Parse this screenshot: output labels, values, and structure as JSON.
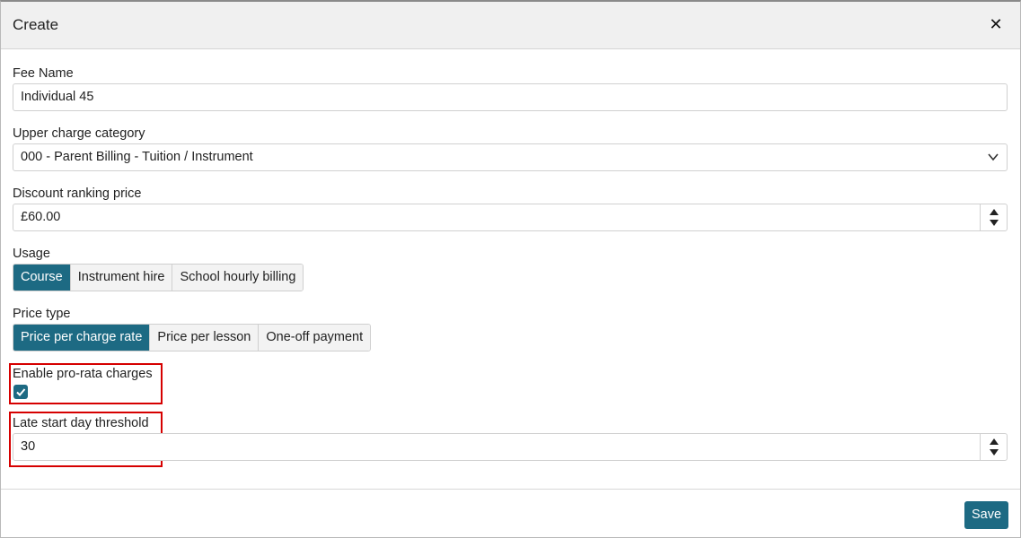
{
  "dialog": {
    "title": "Create",
    "close_icon": "close-icon"
  },
  "fields": {
    "fee_name": {
      "label": "Fee Name",
      "value": "Individual 45"
    },
    "upper_charge_category": {
      "label": "Upper charge category",
      "value": "000 - Parent Billing - Tuition / Instrument"
    },
    "discount_ranking_price": {
      "label": "Discount ranking price",
      "value": "£60.00"
    },
    "usage": {
      "label": "Usage",
      "options": [
        "Course",
        "Instrument hire",
        "School hourly billing"
      ],
      "selected": "Course"
    },
    "price_type": {
      "label": "Price type",
      "options": [
        "Price per charge rate",
        "Price per lesson",
        "One-off payment"
      ],
      "selected": "Price per charge rate"
    },
    "enable_pro_rata": {
      "label": "Enable pro-rata charges",
      "checked": true
    },
    "late_start_day_threshold": {
      "label": "Late start day threshold",
      "value": "30"
    }
  },
  "footer": {
    "save_label": "Save"
  },
  "colors": {
    "accent": "#1d6a83",
    "highlight": "#d60000"
  }
}
